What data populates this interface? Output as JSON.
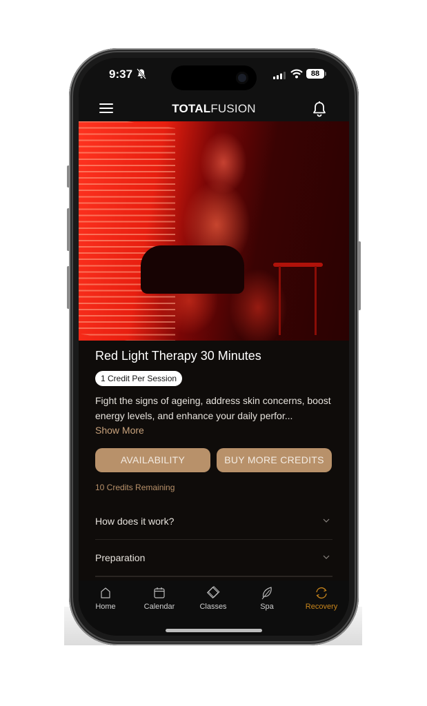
{
  "status_bar": {
    "time": "9:37",
    "silent_icon": "bell-slash-icon",
    "battery": "88"
  },
  "header": {
    "logo_bold": "TOTAL",
    "logo_light": "FUSION",
    "menu_icon": "hamburger-menu-icon",
    "notification_icon": "bell-icon"
  },
  "hero": {
    "image_description": "Man sitting in front of a red light therapy bed"
  },
  "service": {
    "title": "Red Light Therapy 30 Minutes",
    "badge": "1 Credit Per Session",
    "description": "Fight the signs of ageing, address skin concerns, boost energy levels, and enhance your daily perfor...",
    "show_more": "Show More",
    "buttons": {
      "availability": "AVAILABILITY",
      "buy_credits": "BUY MORE CREDITS"
    },
    "credits_remaining": "10 Credits Remaining"
  },
  "accordion": [
    {
      "label": "How does it work?"
    },
    {
      "label": "Preparation"
    }
  ],
  "tabbar": {
    "items": [
      {
        "label": "Home",
        "icon": "home-icon"
      },
      {
        "label": "Calendar",
        "icon": "calendar-icon"
      },
      {
        "label": "Classes",
        "icon": "classes-icon"
      },
      {
        "label": "Spa",
        "icon": "leaf-icon"
      },
      {
        "label": "Recovery",
        "icon": "recovery-icon",
        "active": true
      }
    ]
  },
  "colors": {
    "accent": "#b8916a",
    "active_tab": "#c9861c",
    "background": "#0f0c0a"
  }
}
